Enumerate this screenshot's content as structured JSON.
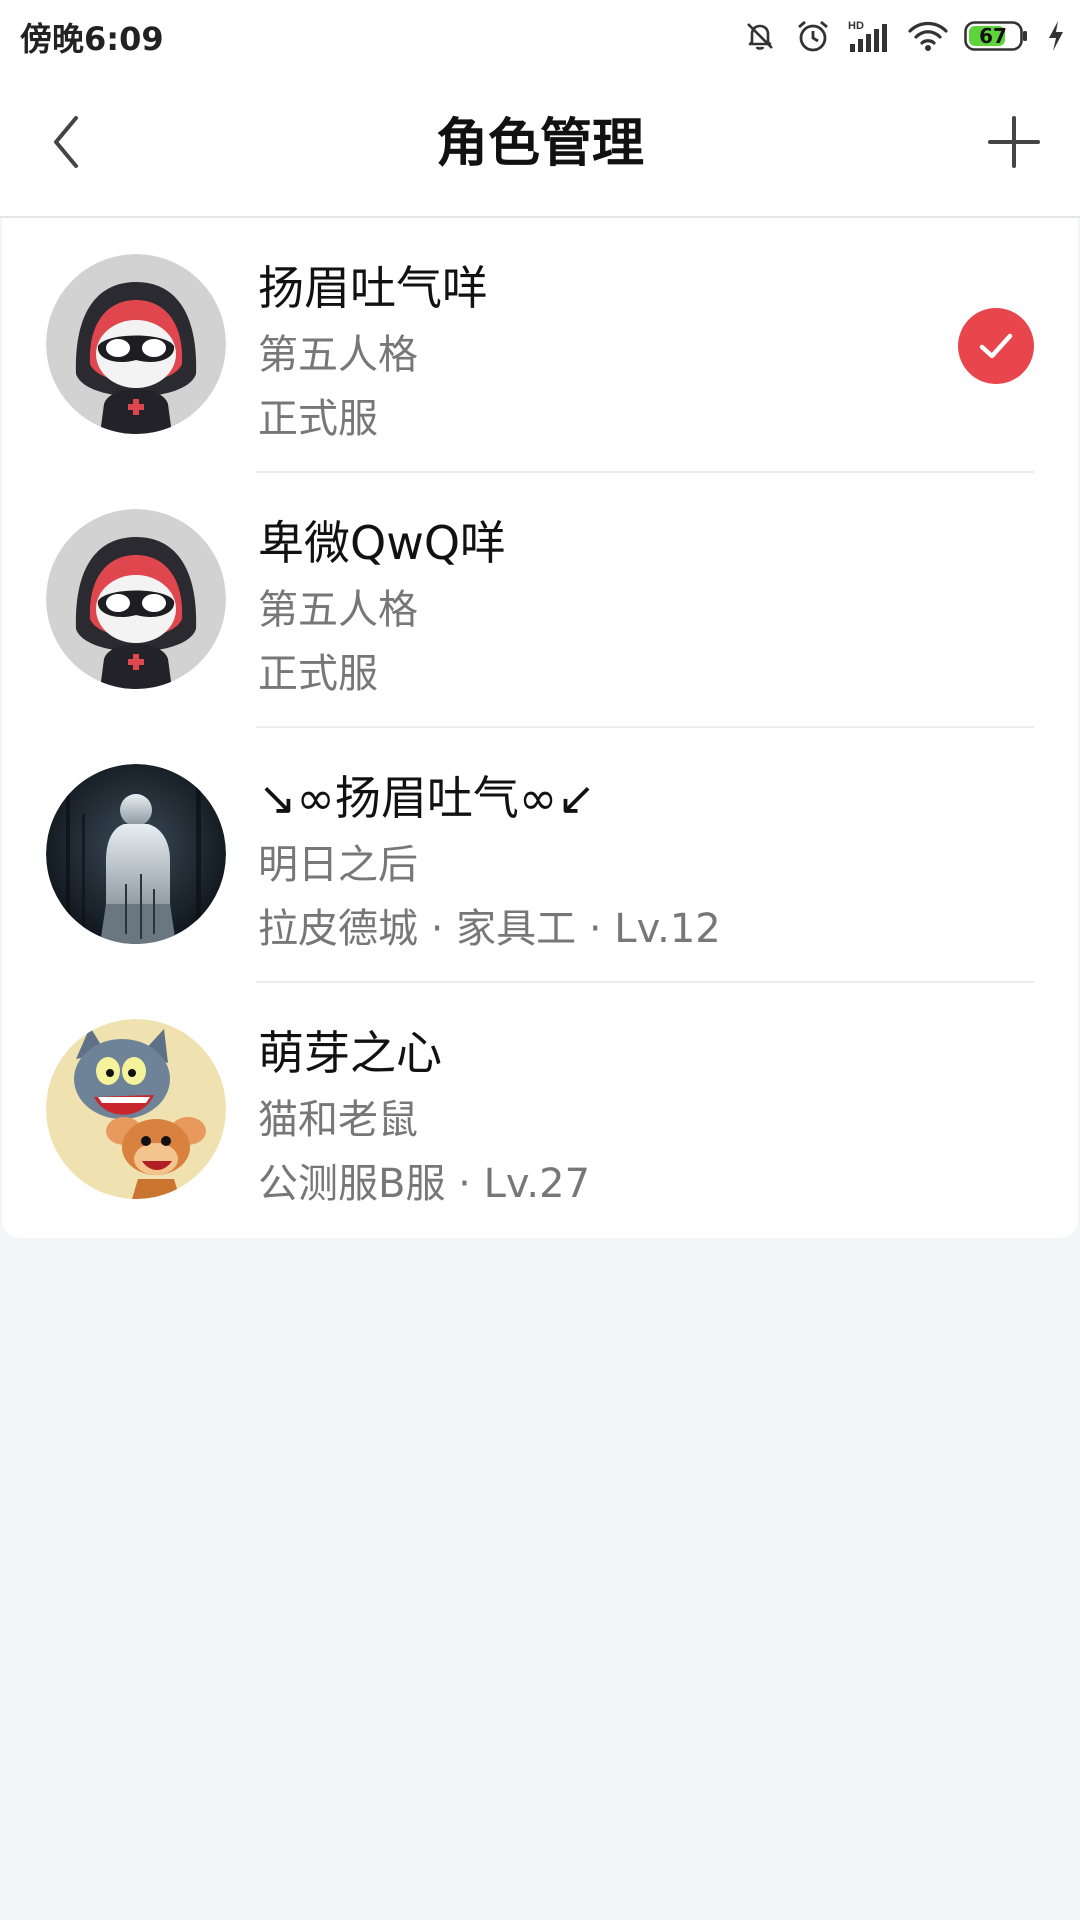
{
  "status_bar": {
    "time": "傍晚6:09",
    "battery": "67",
    "icons": [
      "bell-off-icon",
      "alarm-icon",
      "hd-signal-icon",
      "wifi-icon",
      "battery-icon",
      "charging-icon"
    ]
  },
  "header": {
    "title": "角色管理",
    "back_icon": "chevron-left-icon",
    "add_icon": "plus-icon"
  },
  "roles": [
    {
      "name": "扬眉吐气咩",
      "game": "第五人格",
      "detail": "正式服",
      "avatar": "masked-hood-character",
      "selected": true
    },
    {
      "name": "卑微QwQ咩",
      "game": "第五人格",
      "detail": "正式服",
      "avatar": "masked-hood-character",
      "selected": false
    },
    {
      "name": "↘∞扬眉吐气∞↙",
      "game": "明日之后",
      "detail": "拉皮德城 · 家具工 · Lv.12",
      "avatar": "silhouette-forest",
      "selected": false
    },
    {
      "name": "萌芽之心",
      "game": "猫和老鼠",
      "detail": "公测服B服 · Lv.27",
      "avatar": "cat-and-mouse",
      "selected": false
    }
  ],
  "colors": {
    "accent": "#e8454c",
    "background": "#f4f5f7",
    "battery_green": "#5fd33b"
  }
}
